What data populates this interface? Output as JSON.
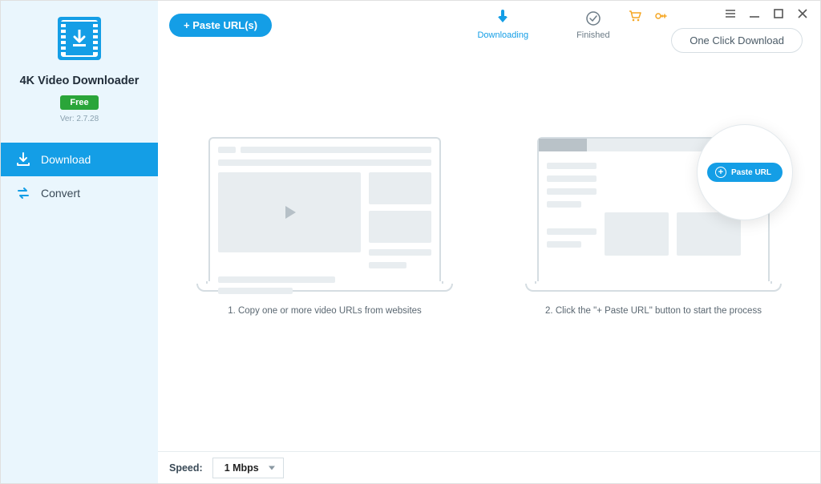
{
  "brand": {
    "title": "4K Video Downloader",
    "badge": "Free",
    "version": "Ver: 2.7.28"
  },
  "nav": {
    "download": "Download",
    "convert": "Convert"
  },
  "toolbar": {
    "paste_label": "+ Paste URL(s)",
    "one_click_label": "One Click Download"
  },
  "tabs": {
    "downloading": "Downloading",
    "finished": "Finished"
  },
  "steps": {
    "step1": "1. Copy one or more video URLs from websites",
    "step2": "2. Click the \"+ Paste URL\" button to start the process",
    "paste_mini": "Paste URL"
  },
  "bottom": {
    "speed_label": "Speed:",
    "speed_value": "1 Mbps"
  }
}
